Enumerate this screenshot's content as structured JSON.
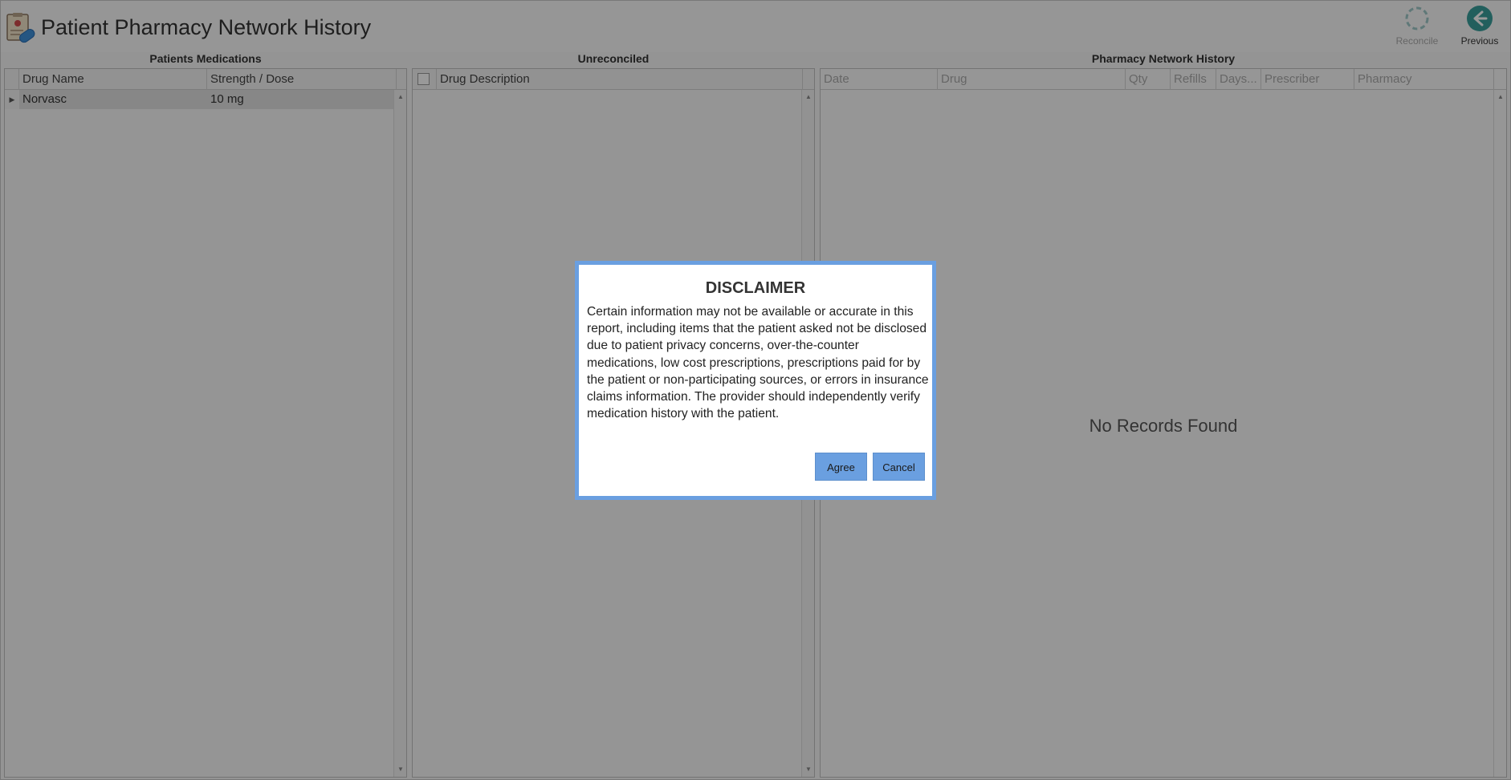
{
  "app": {
    "title": "Patient Pharmacy Network History"
  },
  "toolbar": {
    "reconcile_label": "Reconcile",
    "previous_label": "Previous",
    "reconcile_icon": "refresh-icon",
    "previous_icon": "arrow-left-circle-icon"
  },
  "patient_medications": {
    "title": "Patients Medications",
    "columns": [
      "Drug Name",
      "Strength / Dose"
    ],
    "rows": [
      {
        "drug_name": "Norvasc",
        "strength": "10 mg"
      }
    ]
  },
  "unreconciled": {
    "title": "Unreconciled",
    "columns": [
      "Drug Description"
    ]
  },
  "pharmacy_history": {
    "title": "Pharmacy Network History",
    "columns": [
      "Date",
      "Drug",
      "Qty",
      "Refills",
      "Days...",
      "Prescriber",
      "Pharmacy"
    ],
    "empty_message": "No Records Found"
  },
  "dialog": {
    "title": "DISCLAIMER",
    "body": "Certain information may not be available or accurate in this report, including items that the patient asked not be disclosed due to patient privacy concerns, over-the-counter medications, low cost prescriptions, prescriptions paid for by the patient or non-participating sources, or errors in insurance claims information. The provider should independently verify medication history with the patient.",
    "agree_label": "Agree",
    "cancel_label": "Cancel"
  },
  "colors": {
    "accent": "#6a9fe0",
    "previous_icon": "#3a9e9b",
    "overlay": "rgba(0,0,0,0.40)"
  }
}
